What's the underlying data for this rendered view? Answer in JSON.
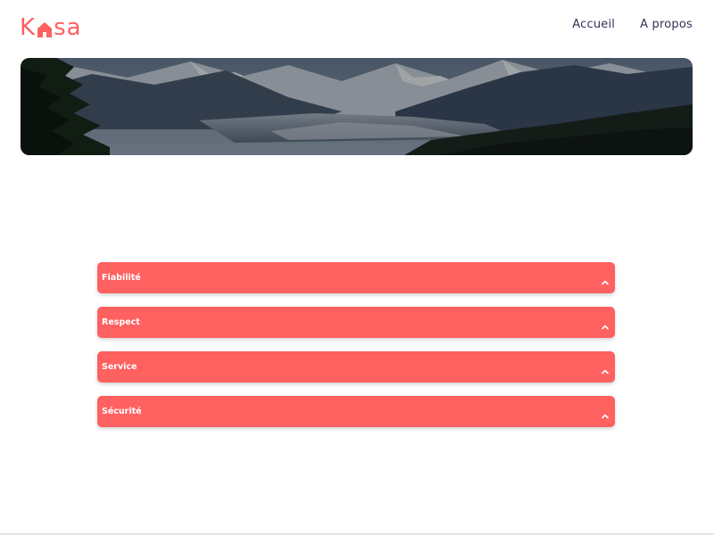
{
  "brand": {
    "logo_text_start": "K",
    "logo_text_end": "sa",
    "accent": "#FF6060"
  },
  "nav": {
    "items": [
      {
        "label": "Accueil"
      },
      {
        "label": "A propos"
      }
    ],
    "color": "#3a2e5a"
  },
  "banner": {
    "image": "mountain-valley-landscape"
  },
  "accordion": {
    "items": [
      {
        "title": "Fiabilité",
        "icon": "chevron-up-icon"
      },
      {
        "title": "Respect",
        "icon": "chevron-up-icon"
      },
      {
        "title": "Service",
        "icon": "chevron-up-icon"
      },
      {
        "title": "Sécurité",
        "icon": "chevron-up-icon"
      }
    ]
  }
}
